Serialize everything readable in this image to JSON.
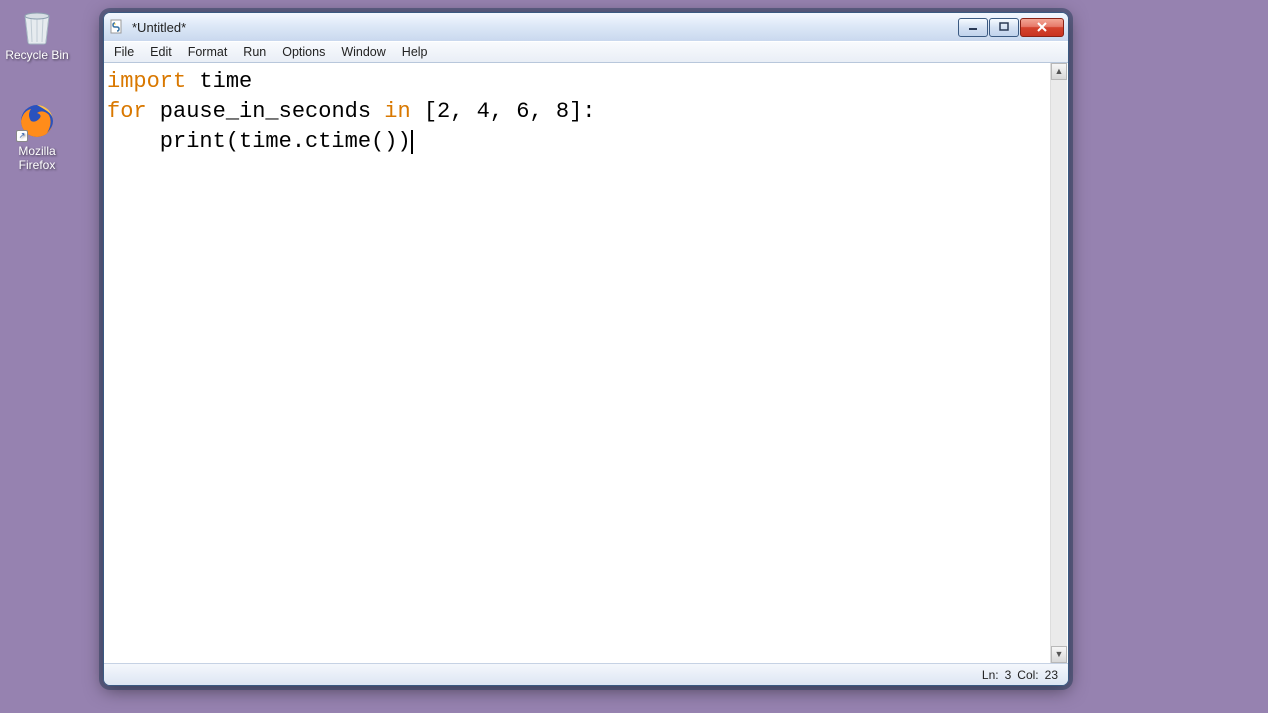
{
  "desktop": {
    "recycle_bin_label": "Recycle Bin",
    "firefox_label": "Mozilla Firefox"
  },
  "window": {
    "title": "*Untitled*"
  },
  "menubar": {
    "file": "File",
    "edit": "Edit",
    "format": "Format",
    "run": "Run",
    "options": "Options",
    "window": "Window",
    "help": "Help"
  },
  "code": {
    "line1_kw": "import",
    "line1_rest": " time",
    "line2_kw1": "for",
    "line2_mid": " pause_in_seconds ",
    "line2_kw2": "in",
    "line2_rest": " [2, 4, 6, 8]:",
    "line3": "    print(time.ctime())"
  },
  "status": {
    "line_label": "Ln:",
    "line_value": "3",
    "col_label": "Col:",
    "col_value": "23"
  }
}
